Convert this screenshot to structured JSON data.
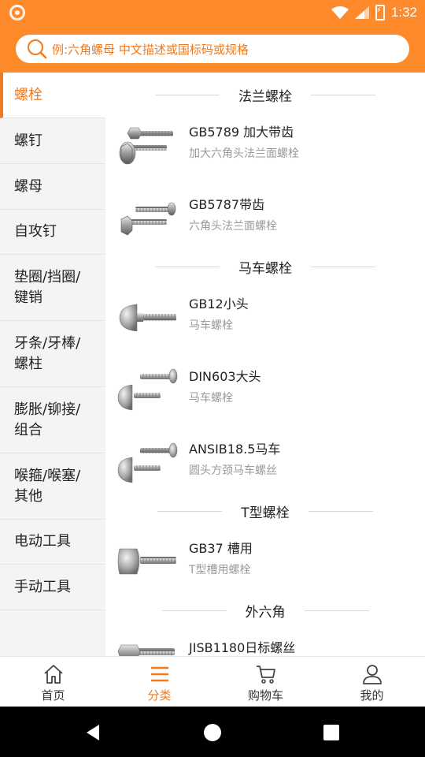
{
  "status_bar": {
    "time": "1:32"
  },
  "search": {
    "placeholder": "例:六角螺母 中文描述或国标码或规格"
  },
  "sidebar": {
    "items": [
      {
        "label": "螺栓",
        "active": true
      },
      {
        "label": "螺钉"
      },
      {
        "label": "螺母"
      },
      {
        "label": "自攻钉"
      },
      {
        "label": "垫圈/挡圈/\n键销"
      },
      {
        "label": "牙条/牙棒/\n螺柱"
      },
      {
        "label": "膨胀/铆接/\n组合"
      },
      {
        "label": "喉箍/喉塞/\n其他"
      },
      {
        "label": "电动工具"
      },
      {
        "label": "手动工具"
      }
    ]
  },
  "sections": [
    {
      "title": "法兰螺栓",
      "products": [
        {
          "name": "GB5789 加大带齿",
          "desc": "加大六角头法兰面螺栓",
          "icon": "flange-bolt-icon"
        },
        {
          "name": "GB5787带齿",
          "desc": "六角头法兰面螺栓",
          "icon": "flange-bolt-icon"
        }
      ]
    },
    {
      "title": "马车螺栓",
      "products": [
        {
          "name": "GB12小头",
          "desc": "马车螺栓",
          "icon": "carriage-bolt-icon"
        },
        {
          "name": "DIN603大头",
          "desc": "马车螺栓",
          "icon": "carriage-bolt-icon"
        },
        {
          "name": "ANSIB18.5马车",
          "desc": "圆头方颈马车螺丝",
          "icon": "carriage-bolt-icon"
        }
      ]
    },
    {
      "title": "T型螺栓",
      "products": [
        {
          "name": "GB37 槽用",
          "desc": "T型槽用螺栓",
          "icon": "t-bolt-icon"
        }
      ]
    },
    {
      "title": "外六角",
      "products": [
        {
          "name": "JISB1180日标螺丝",
          "desc": "",
          "icon": "hex-bolt-icon"
        }
      ]
    }
  ],
  "bottom_nav": {
    "items": [
      {
        "label": "首页",
        "icon": "home-icon"
      },
      {
        "label": "分类",
        "icon": "menu-icon",
        "active": true
      },
      {
        "label": "购物车",
        "icon": "cart-icon"
      },
      {
        "label": "我的",
        "icon": "profile-icon"
      }
    ]
  },
  "colors": {
    "accent": "#ff8a2b",
    "accent_text": "#f07a1f"
  }
}
